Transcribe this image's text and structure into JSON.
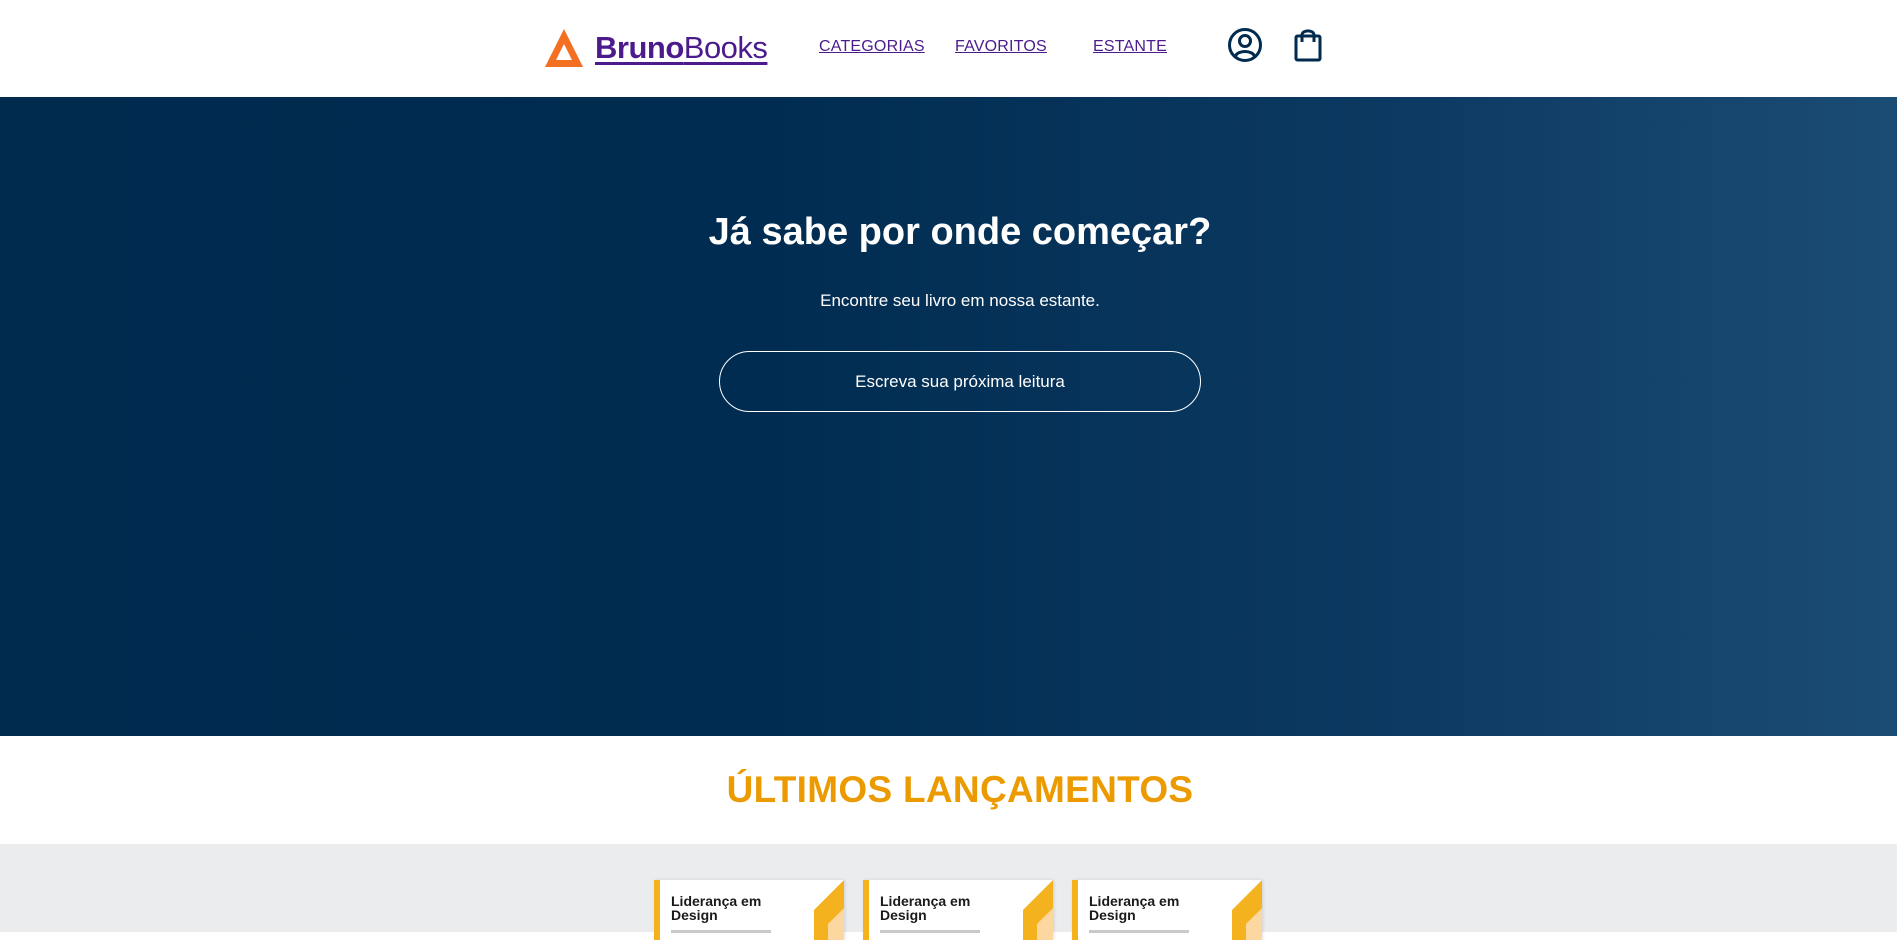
{
  "header": {
    "logo": {
      "brand_bold": "Bruno",
      "brand_light": "Books",
      "icon": "triangle-logo-icon"
    },
    "nav": [
      {
        "label": "CATEGORIAS"
      },
      {
        "label": "FAVORITOS"
      },
      {
        "label": "ESTANTE"
      }
    ],
    "icons": {
      "profile": "user-circle-icon",
      "bag": "shopping-bag-icon"
    }
  },
  "hero": {
    "title": "Já sabe por onde começar?",
    "subtitle": "Encontre seu livro em nossa estante.",
    "search_placeholder": "Escreva sua próxima leitura"
  },
  "releases": {
    "title": "ÚLTIMOS LANÇAMENTOS",
    "books": [
      {
        "title": "Liderança em Design"
      },
      {
        "title": "Liderança em Design"
      },
      {
        "title": "Liderança em Design"
      }
    ]
  },
  "colors": {
    "brand_purple": "#4b1b8c",
    "brand_orange": "#f36f21",
    "hero_dark": "#002a4e",
    "hero_light": "#1b4c74",
    "accent_yellow": "#eb9b00",
    "shelf_bg": "#ebecee"
  }
}
